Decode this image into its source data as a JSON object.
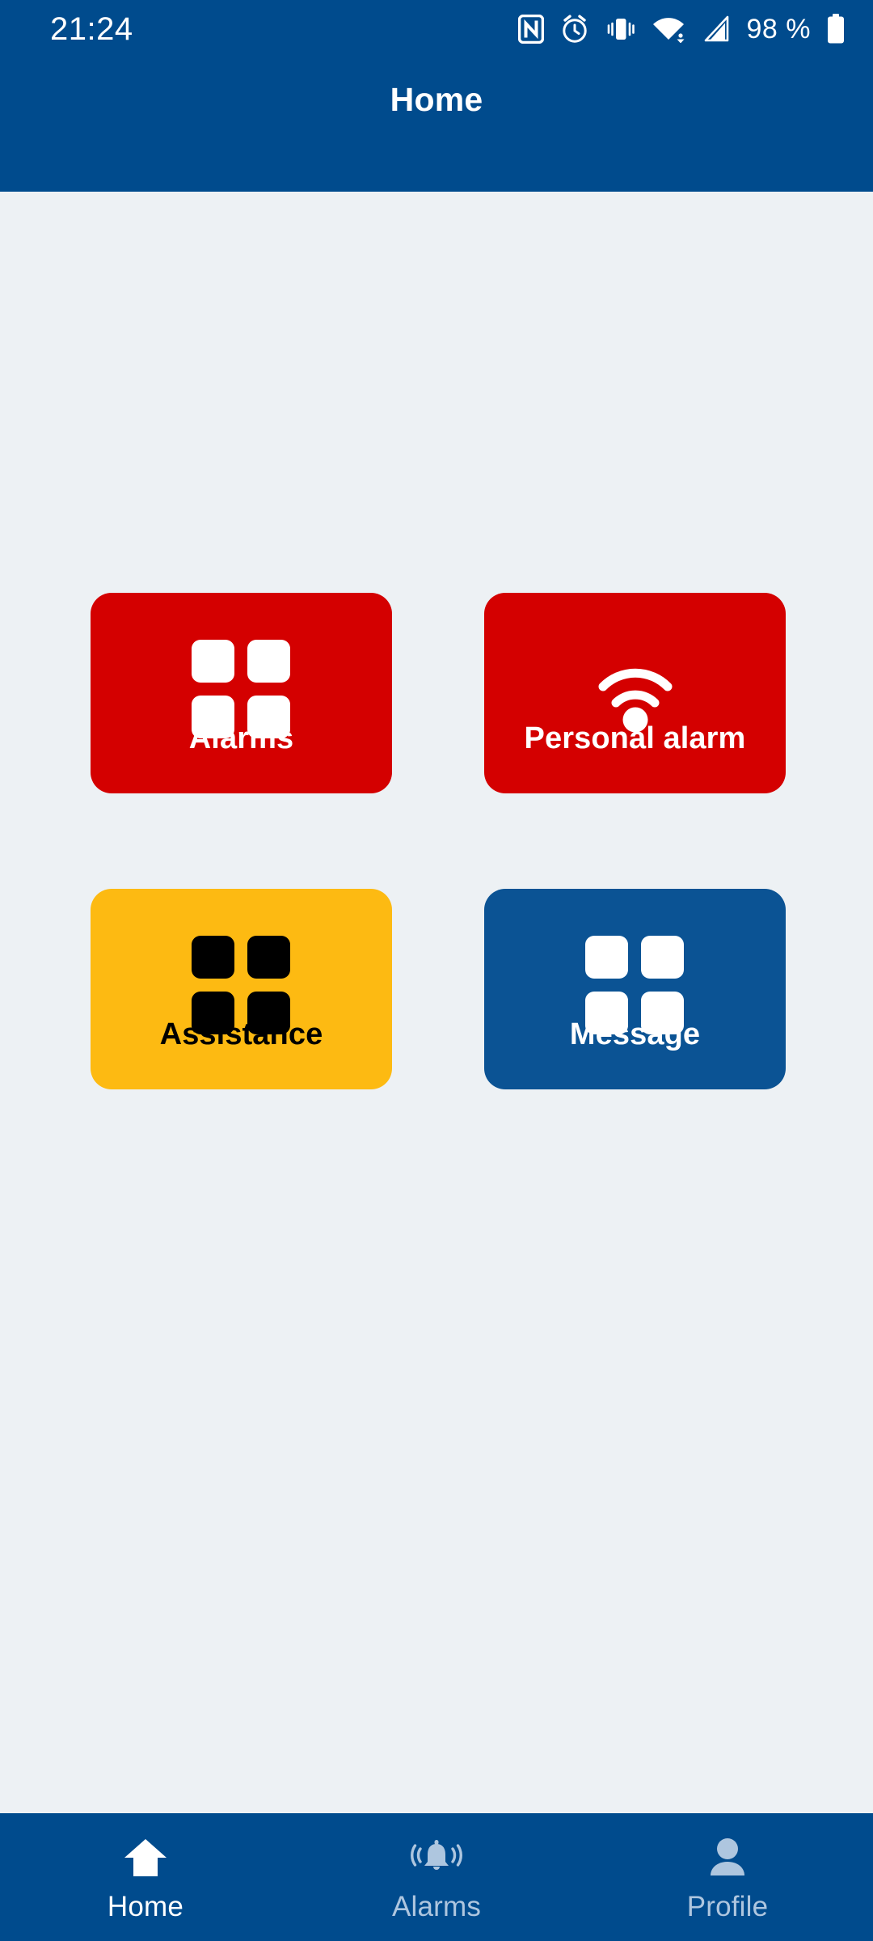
{
  "status_bar": {
    "time": "21:24",
    "battery_percent": "98 %",
    "icons": [
      "nfc-icon",
      "alarm-clock-icon",
      "vibrate-icon",
      "wifi-icon",
      "cellular-signal-icon",
      "battery-icon"
    ]
  },
  "app_bar": {
    "title": "Home"
  },
  "theme": {
    "primary_blue": "#004B8D",
    "background": "#EDF1F4",
    "alarm_red": "#D40000",
    "assistance_amber": "#FDBA12",
    "message_blue": "#0B5394",
    "nav_inactive": "#AEC6DF",
    "nav_active": "#FFFFFF"
  },
  "tiles": [
    {
      "label": "Alarms",
      "icon": "grid-four-squares-icon",
      "bg": "#D40000",
      "text_color": "#FFFFFF"
    },
    {
      "label": "Personal alarm",
      "icon": "wifi-signal-icon",
      "bg": "#D40000",
      "text_color": "#FFFFFF"
    },
    {
      "label": "Assistance",
      "icon": "grid-four-squares-icon",
      "bg": "#FDBA12",
      "text_color": "#000000"
    },
    {
      "label": "Message",
      "icon": "grid-four-squares-icon",
      "bg": "#0B5394",
      "text_color": "#FFFFFF"
    }
  ],
  "bottom_nav": {
    "items": [
      {
        "label": "Home",
        "icon": "house-icon",
        "active": true
      },
      {
        "label": "Alarms",
        "icon": "ringing-bell-icon",
        "active": false
      },
      {
        "label": "Profile",
        "icon": "person-icon",
        "active": false
      }
    ]
  }
}
